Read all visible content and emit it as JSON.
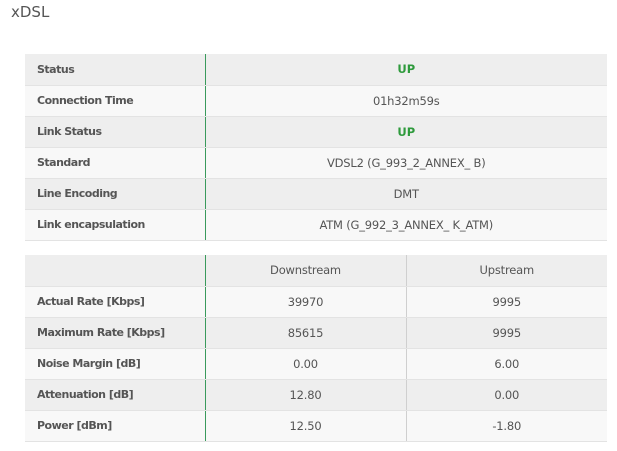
{
  "page": {
    "title": "xDSL"
  },
  "status_table": {
    "rows": [
      {
        "label": "Status",
        "value": "UP"
      },
      {
        "label": "Connection Time",
        "value": "01h32m59s"
      },
      {
        "label": "Link Status",
        "value": "UP"
      },
      {
        "label": "Standard",
        "value": "VDSL2 (G_993_2_ANNEX_ B)"
      },
      {
        "label": "Line Encoding",
        "value": "DMT"
      },
      {
        "label": "Link encapsulation",
        "value": "ATM (G_992_3_ANNEX_ K_ATM)"
      }
    ]
  },
  "rates_table": {
    "columns": [
      "",
      "Downstream",
      "Upstream"
    ],
    "rows": [
      {
        "label": "Actual Rate [Kbps]",
        "downstream": "39970",
        "upstream": "9995"
      },
      {
        "label": "Maximum Rate [Kbps]",
        "downstream": "85615",
        "upstream": "9995"
      },
      {
        "label": "Noise Margin [dB]",
        "downstream": "0.00",
        "upstream": "6.00"
      },
      {
        "label": "Attenuation [dB]",
        "downstream": "12.80",
        "upstream": "0.00"
      },
      {
        "label": "Power [dBm]",
        "downstream": "12.50",
        "upstream": "-1.80"
      }
    ]
  },
  "colors": {
    "status_up": "#2e9a3c",
    "label_divider": "#3a9a5c"
  }
}
